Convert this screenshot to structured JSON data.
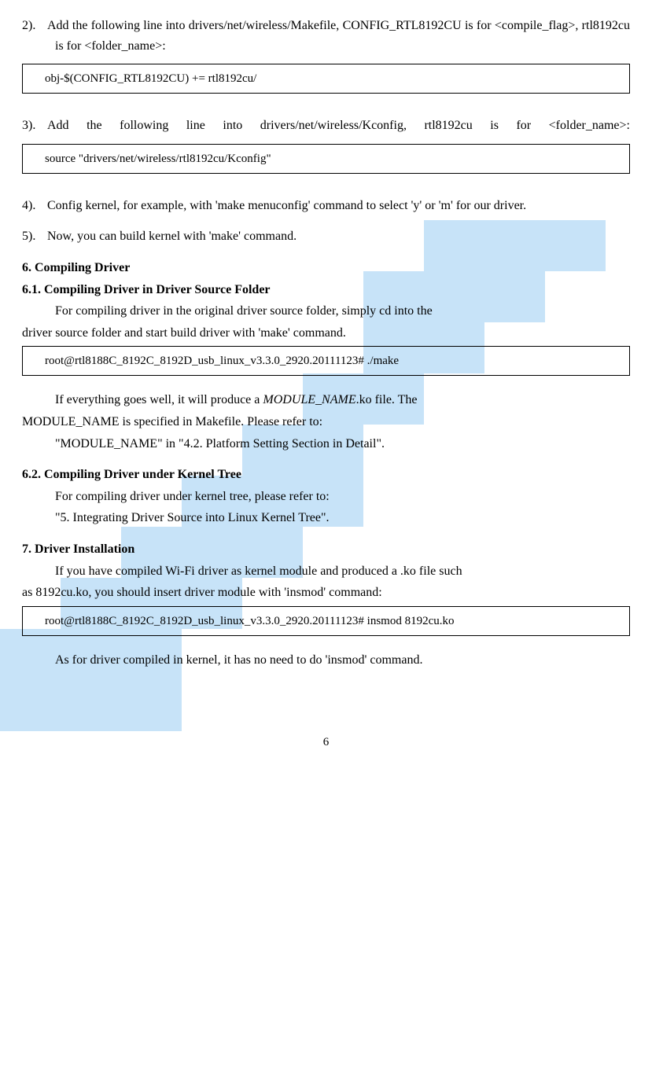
{
  "step2": {
    "text_a": "2).",
    "text_b": "Add the following line into drivers/net/wireless/Makefile, CONFIG_RTL8192CU is for <compile_flag>, rtl8192cu is for <folder_name>:"
  },
  "code1": "obj-$(CONFIG_RTL8192CU)    += rtl8192cu/",
  "step3": {
    "num": "3).",
    "text": "Add  the  following  line  into  drivers/net/wireless/Kconfig,  rtl8192cu  is  for <folder_name>:"
  },
  "code2": "source \"drivers/net/wireless/rtl8192cu/Kconfig\"",
  "step4": {
    "num": "4).",
    "text": "Config kernel, for example, with 'make menuconfig' command to select 'y' or 'm' for our driver."
  },
  "step5": {
    "num": "5).",
    "text": "Now, you can build kernel with 'make' command."
  },
  "sec6": {
    "title": "6.    Compiling Driver",
    "sub1": {
      "title": "6.1.   Compiling Driver in Driver Source Folder",
      "p1": "For compiling driver in the original driver source folder, simply cd into the",
      "p2": "driver source folder and start build driver with 'make' command.",
      "code": "root@rtl8188C_8192C_8192D_usb_linux_v3.3.0_2920.20111123# ./make",
      "p3a": "If everything goes well, it will produce a ",
      "p3b": "MODULE_NAME",
      "p3c": ".ko file. The",
      "p4": "MODULE_NAME is specified in Makefile. Please refer to:",
      "p5": "\"MODULE_NAME\" in \"4.2. Platform Setting Section in Detail\"."
    },
    "sub2": {
      "title": "6.2.   Compiling Driver under Kernel Tree",
      "p1": "For compiling driver under kernel tree, please refer to:",
      "p2": "\"5. Integrating Driver Source into Linux Kernel Tree\"."
    }
  },
  "sec7": {
    "title": "7.    Driver Installation",
    "p1": "If you have compiled Wi-Fi driver as kernel module and produced a .ko file such",
    "p2": "as 8192cu.ko, you should insert driver module with 'insmod' command:",
    "code": "root@rtl8188C_8192C_8192D_usb_linux_v3.3.0_2920.20111123# insmod 8192cu.ko",
    "p3": "As for driver compiled in kernel, it has no need to do 'insmod' command."
  },
  "page": "6"
}
